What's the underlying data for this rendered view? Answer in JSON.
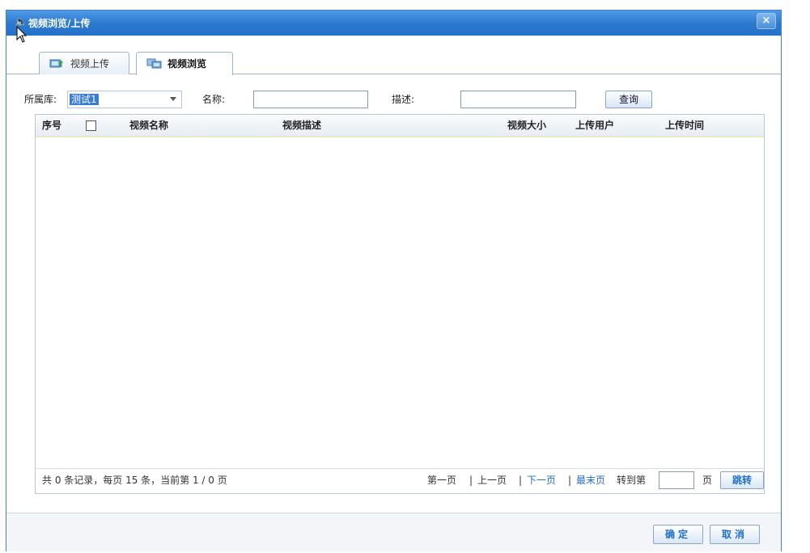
{
  "window": {
    "title": "视频浏览/上传",
    "close_glyph": "×"
  },
  "tabs": [
    {
      "label": "视频上传",
      "icon": "upload-video-icon"
    },
    {
      "label": "视频浏览",
      "icon": "browse-video-icon",
      "selected": true
    }
  ],
  "filter": {
    "library_label": "所属库:",
    "library_value": "测试1",
    "name_label": "名称:",
    "name_value": "",
    "desc_label": "描述:",
    "desc_value": "",
    "query_button": "查询"
  },
  "grid": {
    "columns": [
      "序号",
      "",
      "视频名称",
      "视频描述",
      "视频大小",
      "上传用户",
      "上传时间"
    ],
    "rows": []
  },
  "pagination": {
    "info": "共 0 条记录，每页 15 条，当前第 1 / 0 页",
    "first": "第一页",
    "sep": "|",
    "prev": "上一页",
    "next": "下一页",
    "last": "最末页",
    "goto_prefix": "转到第",
    "goto_suffix": "页",
    "jump_button": "跳转",
    "goto_value": ""
  },
  "footer": {
    "ok": "确定",
    "cancel": "取消"
  },
  "colors": {
    "titlebar": "#2e7ad2",
    "link_blue": "#1f6fd0",
    "selected_bg": "#3a7bd5"
  }
}
